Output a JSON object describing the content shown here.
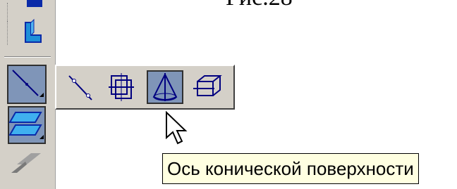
{
  "caption": {
    "text": "Рис.28"
  },
  "tooltip": {
    "text": "Ось конической поверхности"
  },
  "colors": {
    "toolbar_bg": "#d4d0c8",
    "active_bg": "#7f95b8",
    "icon_blue": "#0a2aa8",
    "tooltip_bg": "#ffffe1"
  },
  "toolbar": {
    "buttons": [
      {
        "icon": "partial-top-icon"
      },
      {
        "icon": "l-shape-extrude-icon"
      },
      {
        "icon": "axis-line-icon",
        "pressed": true
      },
      {
        "icon": "plane-icon"
      },
      {
        "icon": "surface-icon"
      }
    ]
  },
  "flyout": {
    "buttons": [
      {
        "icon": "axis-two-points-icon"
      },
      {
        "icon": "axis-two-planes-icon"
      },
      {
        "icon": "conical-surface-axis-icon",
        "active": true
      },
      {
        "icon": "axis-through-edge-icon"
      }
    ]
  }
}
